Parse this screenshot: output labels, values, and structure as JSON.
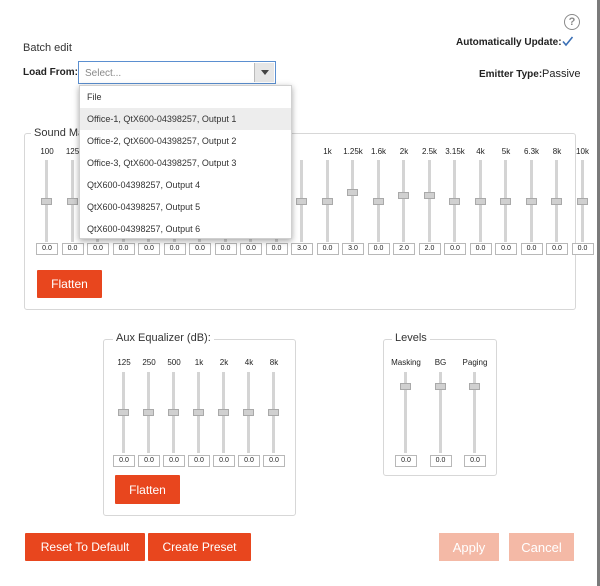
{
  "header": {
    "title": "Batch edit",
    "help_glyph": "?",
    "auto_update_label": "Automatically Update:",
    "auto_update_checked": true,
    "load_from_label": "Load From:",
    "load_from_placeholder": "Select...",
    "emitter_type_label": "Emitter Type:",
    "emitter_type_value": "Passive"
  },
  "dropdown": {
    "options": [
      "File",
      "Office-1, QtX600-04398257, Output 1",
      "Office-2, QtX600-04398257, Output 2",
      "Office-3, QtX600-04398257, Output 3",
      "QtX600-04398257, Output 4",
      "QtX600-04398257, Output 5",
      "QtX600-04398257, Output 6"
    ],
    "highlighted_index": 1
  },
  "sound_masking": {
    "title": "Sound Ma",
    "bands": [
      {
        "freq": "100",
        "value": "0.0",
        "level": 0.5
      },
      {
        "freq": "125",
        "value": "0.0",
        "level": 0.5
      },
      {
        "freq": "",
        "value": "0.0",
        "level": 0.5
      },
      {
        "freq": "",
        "value": "0.0",
        "level": 0.5
      },
      {
        "freq": "",
        "value": "0.0",
        "level": 0.5
      },
      {
        "freq": "",
        "value": "0.0",
        "level": 0.5
      },
      {
        "freq": "",
        "value": "0.0",
        "level": 0.5
      },
      {
        "freq": "",
        "value": "0.0",
        "level": 0.5
      },
      {
        "freq": "",
        "value": "0.0",
        "level": 0.5
      },
      {
        "freq": "",
        "value": "0.0",
        "level": 0.5
      },
      {
        "freq": "",
        "value": "3.0",
        "level": 0.5
      },
      {
        "freq": "1k",
        "value": "0.0",
        "level": 0.5
      },
      {
        "freq": "1.25k",
        "value": "3.0",
        "level": 0.62
      },
      {
        "freq": "1.6k",
        "value": "0.0",
        "level": 0.5
      },
      {
        "freq": "2k",
        "value": "2.0",
        "level": 0.58
      },
      {
        "freq": "2.5k",
        "value": "2.0",
        "level": 0.58
      },
      {
        "freq": "3.15k",
        "value": "0.0",
        "level": 0.5
      },
      {
        "freq": "4k",
        "value": "0.0",
        "level": 0.5
      },
      {
        "freq": "5k",
        "value": "0.0",
        "level": 0.5
      },
      {
        "freq": "6.3k",
        "value": "0.0",
        "level": 0.5
      },
      {
        "freq": "8k",
        "value": "0.0",
        "level": 0.5
      },
      {
        "freq": "10k",
        "value": "0.0",
        "level": 0.5
      }
    ],
    "flatten_label": "Flatten"
  },
  "aux_eq": {
    "title": "Aux Equalizer (dB):",
    "bands": [
      {
        "freq": "125",
        "value": "0.0",
        "level": 0.5
      },
      {
        "freq": "250",
        "value": "0.0",
        "level": 0.5
      },
      {
        "freq": "500",
        "value": "0.0",
        "level": 0.5
      },
      {
        "freq": "1k",
        "value": "0.0",
        "level": 0.5
      },
      {
        "freq": "2k",
        "value": "0.0",
        "level": 0.5
      },
      {
        "freq": "4k",
        "value": "0.0",
        "level": 0.5
      },
      {
        "freq": "8k",
        "value": "0.0",
        "level": 0.5
      }
    ],
    "flatten_label": "Flatten"
  },
  "levels": {
    "title": "Levels",
    "channels": [
      {
        "name": "Masking",
        "value": "0.0",
        "level": 0.85
      },
      {
        "name": "BG",
        "value": "0.0",
        "level": 0.85
      },
      {
        "name": "Paging",
        "value": "0.0",
        "level": 0.85
      }
    ]
  },
  "footer": {
    "reset_label": "Reset To Default",
    "create_preset_label": "Create Preset",
    "apply_label": "Apply",
    "cancel_label": "Cancel"
  },
  "colors": {
    "accent": "#e8461e",
    "accent_disabled": "#f4b9a6",
    "focus_border": "#5b8fd0"
  }
}
